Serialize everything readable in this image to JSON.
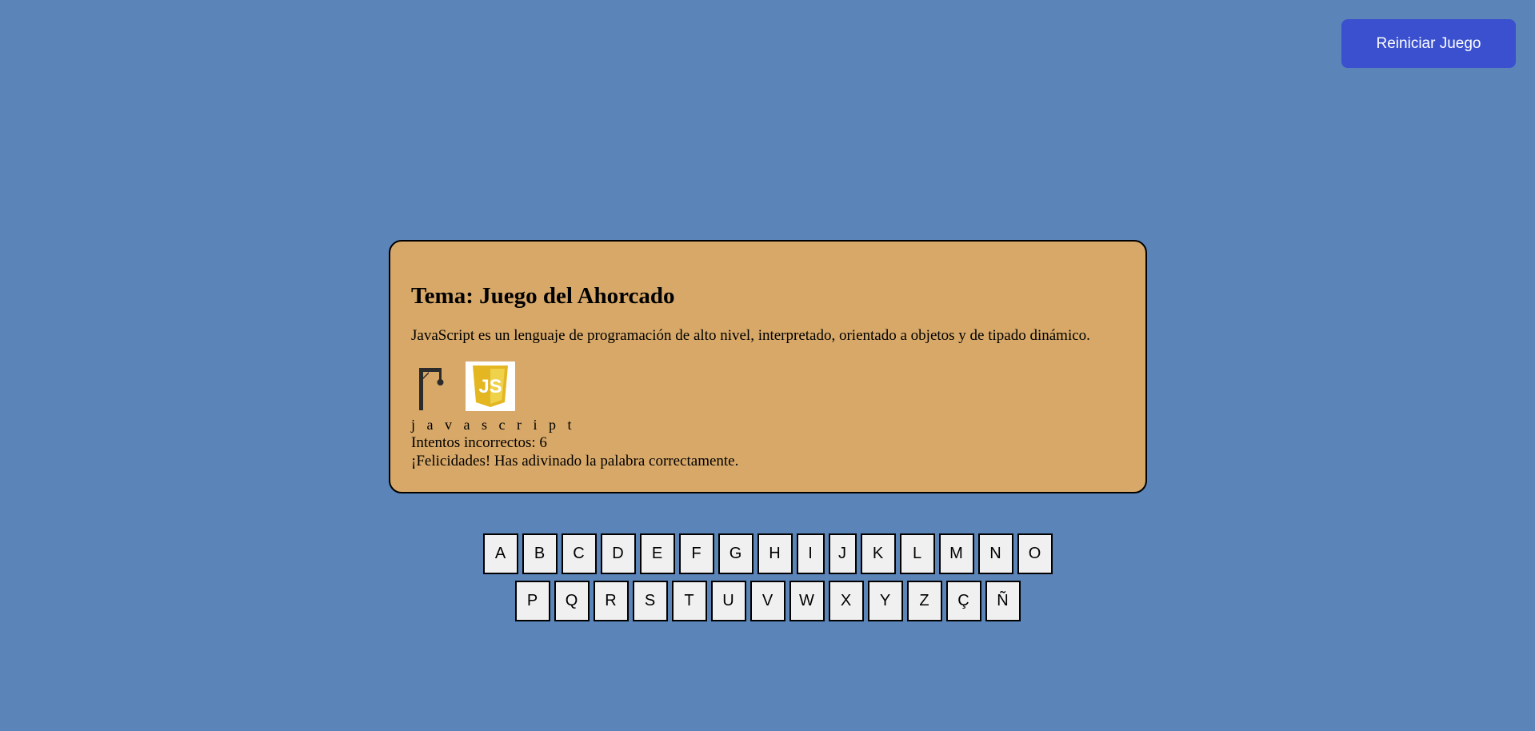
{
  "header": {
    "restart_label": "Reiniciar Juego"
  },
  "game": {
    "title": "Tema: Juego del Ahorcado",
    "description": "JavaScript es un lenguaje de programación de alto nivel, interpretado, orientado a objetos y de tipado dinámico.",
    "word": "j a v a s c r i p t",
    "incorrect_attempts": "Intentos incorrectos: 6",
    "status_message": "¡Felicidades! Has adivinado la palabra correctamente.",
    "hangman_image": "hangman-gallows-icon",
    "topic_image": "javascript-logo-icon",
    "logo_letters": "JS"
  },
  "keyboard": {
    "row1": [
      "A",
      "B",
      "C",
      "D",
      "E",
      "F",
      "G",
      "H",
      "I",
      "J",
      "K",
      "L",
      "M",
      "N",
      "O"
    ],
    "row2": [
      "P",
      "Q",
      "R",
      "S",
      "T",
      "U",
      "V",
      "W",
      "X",
      "Y",
      "Z",
      "Ç",
      "Ñ"
    ]
  },
  "colors": {
    "background": "#5b84b8",
    "card": "#d7a868",
    "button": "#3a50cf",
    "key": "#f0f0f0",
    "js_yellow": "#e8c12c"
  }
}
